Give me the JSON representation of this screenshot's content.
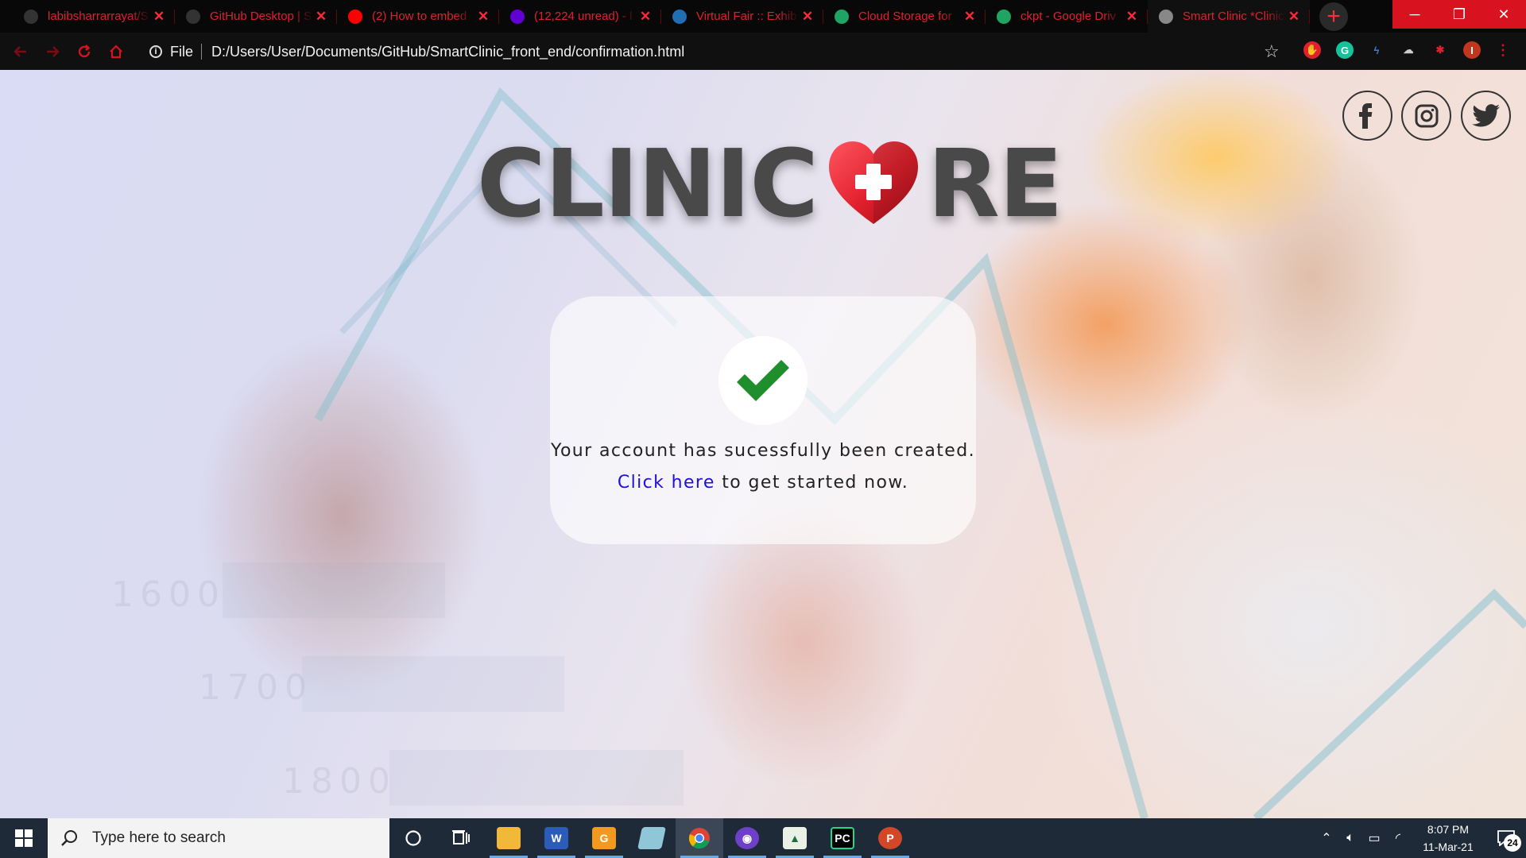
{
  "browser": {
    "tabs": [
      {
        "title": "labibsharrarrayat/S",
        "favicon": "github-icon",
        "color": "#333333"
      },
      {
        "title": "GitHub Desktop | S",
        "favicon": "github-icon",
        "color": "#333333"
      },
      {
        "title": "(2) How to embed",
        "favicon": "youtube-icon",
        "color": "#ff0000"
      },
      {
        "title": "(12,224 unread) - l",
        "favicon": "yahoo-mail-icon",
        "color": "#6001d2"
      },
      {
        "title": "Virtual Fair :: Exhib",
        "favicon": "virtual-fair-icon",
        "color": "#1f6fb2"
      },
      {
        "title": "Cloud Storage for",
        "favicon": "google-drive-icon",
        "color": "#1fa463"
      },
      {
        "title": "ckpt - Google Driv",
        "favicon": "google-drive-icon",
        "color": "#1fa463"
      },
      {
        "title": "Smart Clinic *Clinic",
        "favicon": "globe-icon",
        "color": "#888888"
      }
    ],
    "close_glyph": "✕",
    "new_tab_glyph": "+",
    "window": {
      "minimize": "─",
      "restore": "❐",
      "close": "✕"
    },
    "address": {
      "scheme": "File",
      "url": "D:/Users/User/Documents/GitHub/SmartClinic_front_end/confirmation.html"
    },
    "profile_initial": "I"
  },
  "page": {
    "logo": {
      "left": "CLINIC",
      "right": "RE"
    },
    "social": [
      "facebook-icon",
      "instagram-icon",
      "twitter-icon"
    ],
    "confirmation": {
      "message": "Your account has sucessfully been created.",
      "link_text": "Click here",
      "after_link": " to get started now."
    },
    "background_numbers": [
      "1600",
      "1700",
      "1800"
    ]
  },
  "taskbar": {
    "search_placeholder": "Type here to search",
    "apps": [
      {
        "name": "file-explorer-icon",
        "running": true
      },
      {
        "name": "word-icon",
        "running": true
      },
      {
        "name": "gmail-desktop-icon",
        "running": true
      },
      {
        "name": "notepad-icon",
        "running": false
      },
      {
        "name": "chrome-icon",
        "running": true,
        "active": true
      },
      {
        "name": "github-desktop-icon",
        "running": true
      },
      {
        "name": "excel-chart-icon",
        "running": true
      },
      {
        "name": "pycharm-icon",
        "running": true
      },
      {
        "name": "powerpoint-icon",
        "running": true
      }
    ],
    "time": "8:07 PM",
    "date": "11-Mar-21",
    "notification_count": "24"
  },
  "colors": {
    "accent_red": "#d9121f",
    "link_blue": "#1c10e0",
    "heart_red": "#e4222e"
  }
}
